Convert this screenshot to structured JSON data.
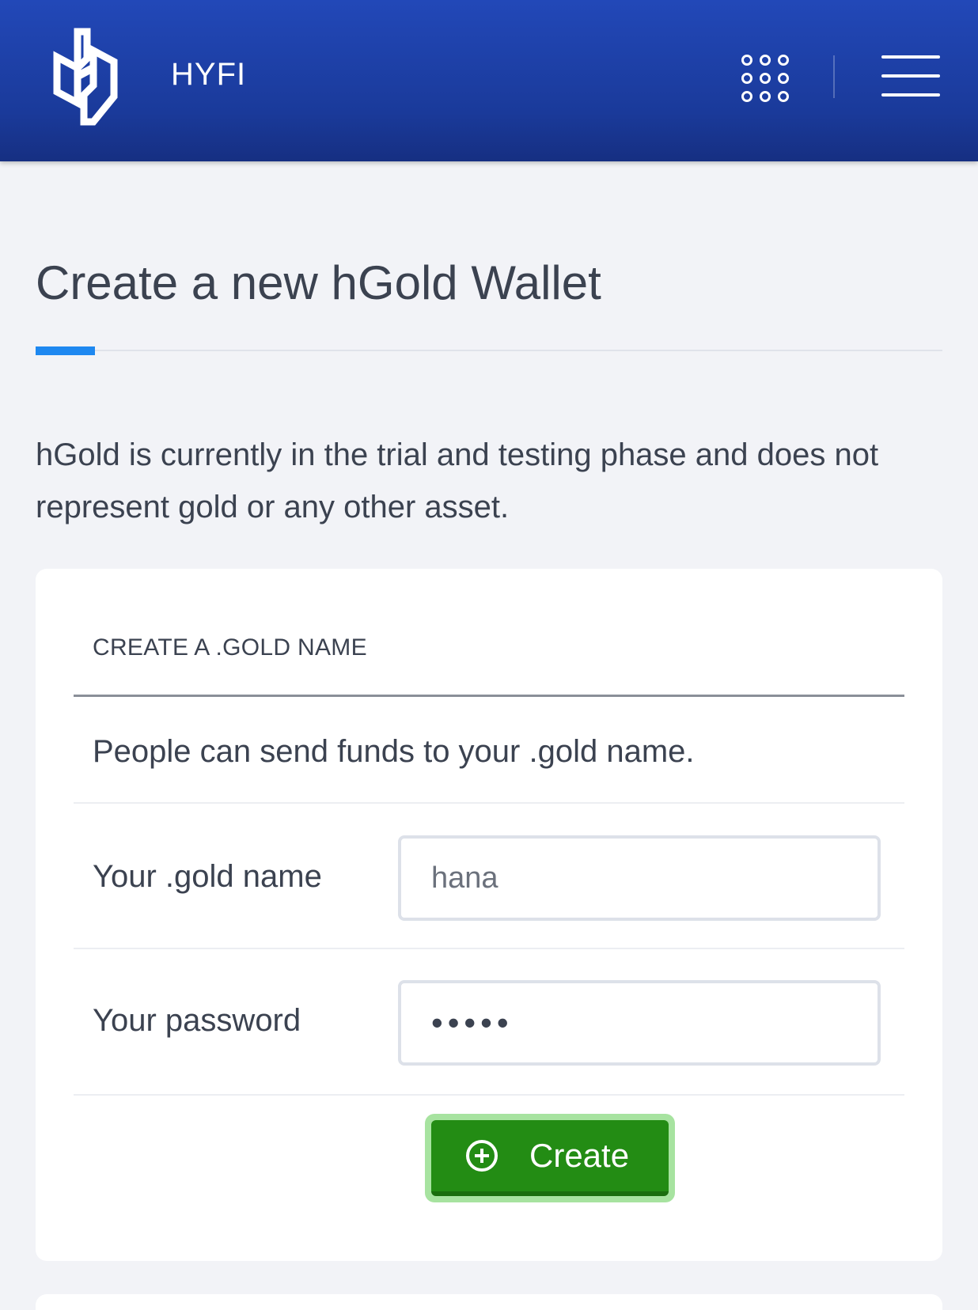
{
  "header": {
    "brand": "HYFI",
    "logo_icon": "hyfi-h-logo",
    "apps_icon": "apps-grid-icon",
    "menu_icon": "hamburger-menu-icon"
  },
  "page": {
    "title": "Create a new hGold Wallet",
    "notice": "hGold is currently in the trial and testing phase and does not represent gold or any other asset."
  },
  "card": {
    "header": "CREATE A .GOLD NAME",
    "subtitle": "People can send funds to your .gold name.",
    "name_field": {
      "label": "Your .gold name",
      "value": "hana"
    },
    "password_field": {
      "label": "Your password",
      "value": "•••••"
    },
    "create_button": {
      "label": "Create",
      "icon": "plus-circle-icon"
    }
  },
  "colors": {
    "header_bg": "#1e40a8",
    "accent": "#1e88f0",
    "button_green": "#238c14",
    "button_glow": "#a7e3a0"
  }
}
